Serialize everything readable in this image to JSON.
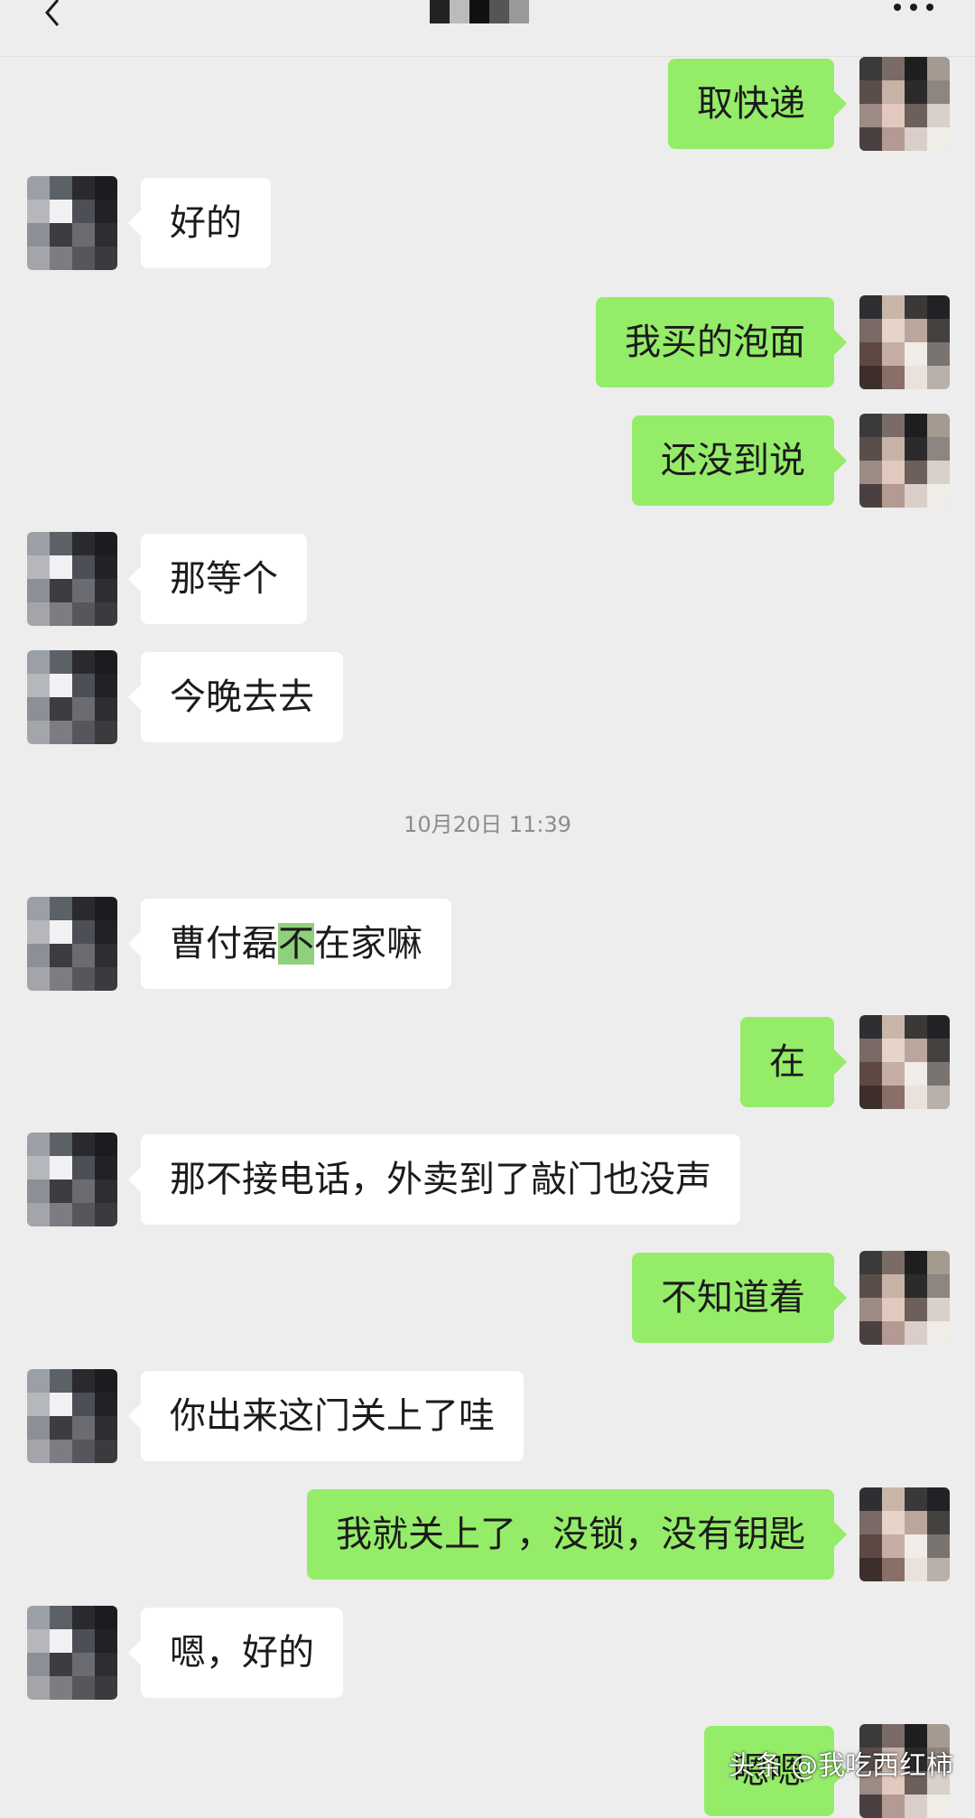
{
  "header": {
    "back_icon": "chevron-left-icon",
    "more_icon": "more-dots-icon"
  },
  "colors": {
    "background": "#ededed",
    "outgoing_bubble": "#95ec69",
    "incoming_bubble": "#ffffff",
    "highlight": "#8fd07d"
  },
  "messages": [
    {
      "side": "out",
      "text": "取快递"
    },
    {
      "side": "in",
      "text": "好的"
    },
    {
      "side": "out",
      "text": "我买的泡面"
    },
    {
      "side": "out",
      "text": "还没到说"
    },
    {
      "side": "in",
      "text": "那等个"
    },
    {
      "side": "in",
      "text": "今晚去去"
    },
    {
      "side": "in",
      "text_before": "曹付磊",
      "text_highlight": "不",
      "text_after": "在家嘛"
    },
    {
      "side": "out",
      "text": "在"
    },
    {
      "side": "in",
      "text": "那不接电话，外卖到了敲门也没声"
    },
    {
      "side": "out",
      "text": "不知道着"
    },
    {
      "side": "in",
      "text": "你出来这门关上了哇"
    },
    {
      "side": "out",
      "text": "我就关上了，没锁，没有钥匙"
    },
    {
      "side": "in",
      "text": "嗯，好的"
    },
    {
      "side": "out",
      "text": "嗯嗯"
    }
  ],
  "timestamp": "10月20日 11:39",
  "watermark": "头条 @我吃西红柿"
}
